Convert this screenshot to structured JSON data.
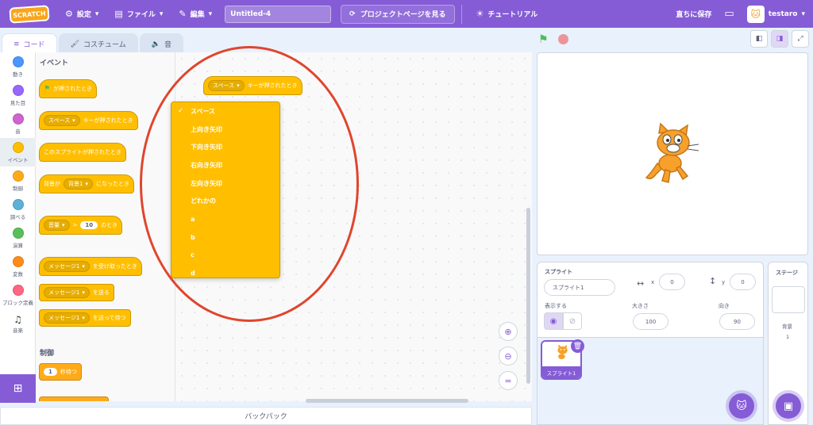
{
  "header": {
    "logo": "SCRATCH",
    "settings": "設定",
    "file": "ファイル",
    "edit": "編集",
    "project_title": "Untitled-4",
    "project_page": "プロジェクトページを見る",
    "tutorials": "チュートリアル",
    "save_now": "直ちに保存",
    "username": "testaro"
  },
  "tabs": {
    "code": "コード",
    "costumes": "コスチューム",
    "sounds": "音"
  },
  "categories": [
    {
      "label": "動き",
      "color": "#4c97ff"
    },
    {
      "label": "見た目",
      "color": "#9966ff"
    },
    {
      "label": "音",
      "color": "#cf63cf"
    },
    {
      "label": "イベント",
      "color": "#ffbf00"
    },
    {
      "label": "制御",
      "color": "#ffab19"
    },
    {
      "label": "調べる",
      "color": "#5cb1d6"
    },
    {
      "label": "演算",
      "color": "#59c059"
    },
    {
      "label": "変数",
      "color": "#ff8c1a"
    },
    {
      "label": "ブロック定義",
      "color": "#ff6680"
    },
    {
      "label": "音楽",
      "color": ""
    }
  ],
  "palette": {
    "events_heading": "イベント",
    "control_heading": "制御",
    "flag_clicked": "が押されたとき",
    "key_value": "スペース",
    "key_pressed": "キーが押されたとき",
    "sprite_clicked": "このスプライトが押されたとき",
    "backdrop_prefix": "背景が",
    "backdrop_value": "背景1",
    "backdrop_suffix": "になったとき",
    "loudness": "音量",
    "gt": ">",
    "loudness_value": "10",
    "loudness_suffix": "のとき",
    "message_value": "メッセージ1",
    "receive_suffix": "を受け取ったとき",
    "broadcast_suffix": "を送る",
    "broadcast_wait_suffix": "を送って待つ",
    "wait_value": "1",
    "wait_suffix": "秒待つ"
  },
  "script": {
    "block_key": "スペース",
    "block_text": "キーが押されたとき"
  },
  "dropdown": {
    "checkmark": "✓",
    "items": [
      "スペース",
      "上向き矢印",
      "下向き矢印",
      "右向き矢印",
      "左向き矢印",
      "どれかの",
      "a",
      "b",
      "c",
      "d"
    ]
  },
  "backpack": "バックパック",
  "sprite_info": {
    "sprite_label": "スプライト",
    "sprite_name": "スプライト1",
    "x_label": "x",
    "x_value": "0",
    "y_label": "y",
    "y_value": "0",
    "show_label": "表示する",
    "size_label": "大きさ",
    "size_value": "100",
    "direction_label": "向き",
    "direction_value": "90"
  },
  "sprite_list": {
    "thumb_label": "スプライト1"
  },
  "stage_panel": {
    "title": "ステージ",
    "backdrops_label": "背景",
    "backdrops_count": "1"
  },
  "colors": {
    "menubar": "#855cd6",
    "events": "#ffbf00",
    "control": "#ffab19",
    "annotation": "#e0452e"
  }
}
